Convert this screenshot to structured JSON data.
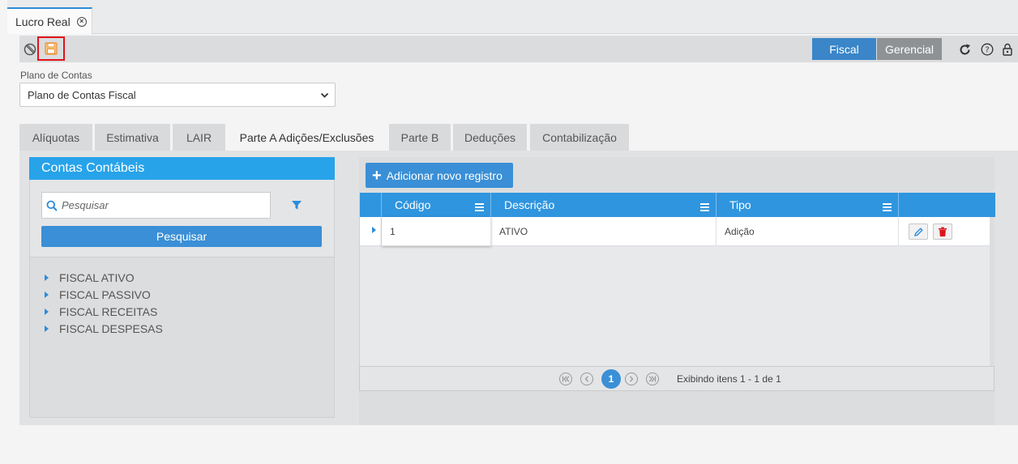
{
  "window": {
    "tab_title": "Lucro Real",
    "tab_close_icon": "close-circle-icon"
  },
  "toolbar": {
    "cancel_icon": "cancel-icon",
    "save_icon": "save-floppy-icon",
    "mode_fiscal": "Fiscal",
    "mode_gerencial": "Gerencial",
    "refresh_icon": "refresh-icon",
    "help_icon": "help-icon",
    "lock_icon": "lock-icon",
    "accent_color": "#3a86c8",
    "highlight_color": "#e0141a"
  },
  "plano": {
    "label": "Plano de Contas",
    "selected": "Plano de Contas Fiscal"
  },
  "tabs": [
    {
      "label": "Alíquotas",
      "active": false
    },
    {
      "label": "Estimativa",
      "active": false
    },
    {
      "label": "LAIR",
      "active": false
    },
    {
      "label": "Parte A Adições/Exclusões",
      "active": true
    },
    {
      "label": "Parte B",
      "active": false
    },
    {
      "label": "Deduções",
      "active": false
    },
    {
      "label": "Contabilização",
      "active": false
    }
  ],
  "contas": {
    "title": "Contas Contábeis",
    "search_placeholder": "Pesquisar",
    "search_button": "Pesquisar",
    "tree": [
      "FISCAL ATIVO",
      "FISCAL PASSIVO",
      "FISCAL RECEITAS",
      "FISCAL DESPESAS"
    ]
  },
  "grid": {
    "add_button": "Adicionar novo registro",
    "columns": [
      "Código",
      "Descrição",
      "Tipo"
    ],
    "rows": [
      {
        "codigo": "1",
        "descricao": "ATIVO",
        "tipo": "Adição"
      }
    ],
    "pager": {
      "current_page": "1",
      "info": "Exibindo itens 1 - 1 de 1"
    }
  }
}
